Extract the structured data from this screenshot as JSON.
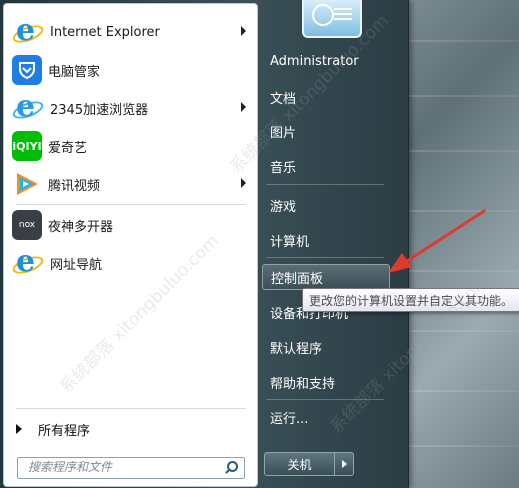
{
  "left_pane": {
    "programs": [
      {
        "label": "Internet Explorer",
        "icon": "internet-explorer-icon",
        "has_submenu": true
      },
      {
        "label": "电脑管家",
        "icon": "tencent-pc-manager-icon",
        "has_submenu": false
      },
      {
        "label": "2345加速浏览器",
        "icon": "2345-browser-icon",
        "has_submenu": true
      },
      {
        "label": "爱奇艺",
        "icon": "iqiyi-icon",
        "has_submenu": false
      },
      {
        "label": "腾讯视频",
        "icon": "tencent-video-icon",
        "has_submenu": true
      },
      {
        "label": "夜神多开器",
        "icon": "nox-icon",
        "has_submenu": false
      },
      {
        "label": "网址导航",
        "icon": "internet-explorer-icon",
        "has_submenu": false
      }
    ],
    "all_programs_label": "所有程序",
    "search_placeholder": "搜索程序和文件"
  },
  "right_pane": {
    "user_name": "Administrator",
    "items": [
      "文档",
      "图片",
      "音乐",
      "游戏",
      "计算机",
      "控制面板",
      "设备和打印机",
      "默认程序",
      "帮助和支持",
      "运行..."
    ],
    "highlighted_item": "控制面板",
    "shutdown_label": "关机"
  },
  "tooltip": {
    "text": "更改您的计算机设置并自定义其功能。"
  },
  "watermark": {
    "text": "系统部落 xitongbuluo.com"
  },
  "colors": {
    "annotation_arrow": "#e03a2e",
    "menu_dark": "#2b3d44",
    "hover_item": "#4d5f66"
  }
}
